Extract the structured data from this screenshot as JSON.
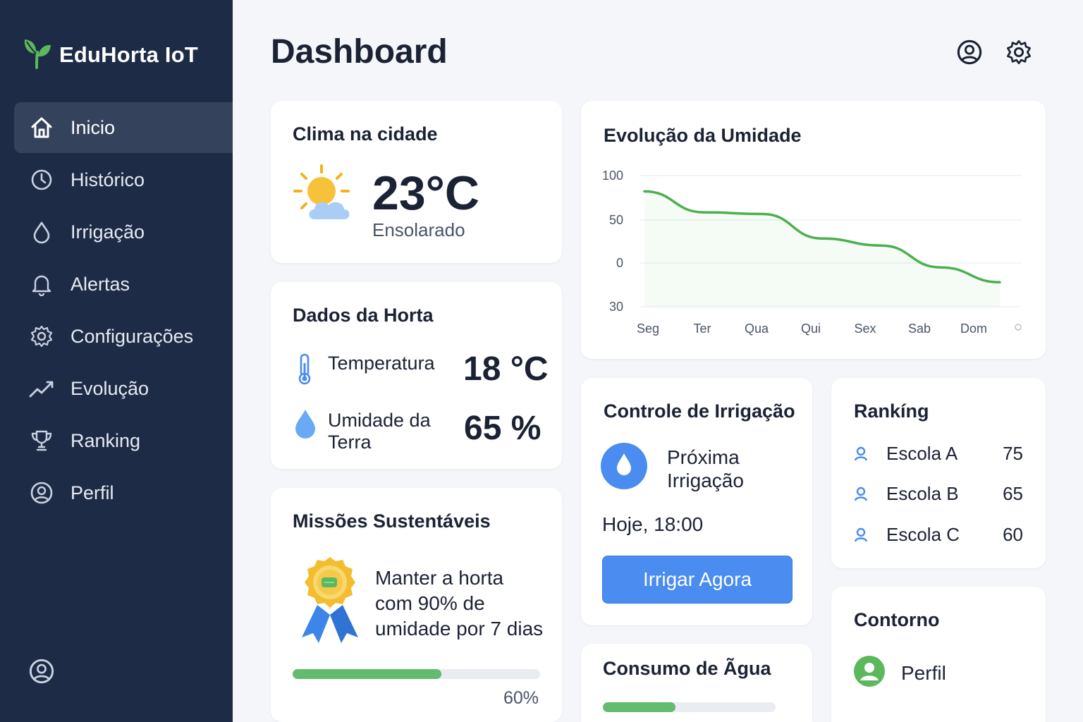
{
  "app": {
    "name": "EduHorta IoT"
  },
  "colors": {
    "sidebar": "#1e2b46",
    "accent_blue": "#4a8cf0",
    "accent_green": "#62bb6e",
    "background": "#f4f6f9"
  },
  "sidebar": {
    "items": [
      {
        "label": "Inicio",
        "icon": "home-icon",
        "active": true
      },
      {
        "label": "Histórico",
        "icon": "clock-icon",
        "active": false
      },
      {
        "label": "Irrigação",
        "icon": "droplet-icon",
        "active": false
      },
      {
        "label": "Alertas",
        "icon": "bell-icon",
        "active": false
      },
      {
        "label": "Configurações",
        "icon": "gear-icon",
        "active": false
      },
      {
        "label": "Evolução",
        "icon": "trend-icon",
        "active": false
      },
      {
        "label": "Ranking",
        "icon": "trophy-icon",
        "active": false
      },
      {
        "label": "Perfil",
        "icon": "user-circle-icon",
        "active": false
      }
    ]
  },
  "header": {
    "title": "Dashboard"
  },
  "weather": {
    "title": "Clima na cidade",
    "temperature": "23°C",
    "condition": "Ensolarado",
    "icon": "sun-cloud-icon"
  },
  "garden": {
    "title": "Dados da Horta",
    "temperature_label": "Temperatura",
    "temperature_value": "18 °C",
    "moisture_label_line1": "Umidade da",
    "moisture_label_line2": "Terra",
    "moisture_value": "65 %"
  },
  "missions": {
    "title": "Missões Sustentáveis",
    "line1": "Manter a horta",
    "line2": "com 90% de",
    "line3": "umidade por 7 dias",
    "progress_percent": 60,
    "progress_label": "60%"
  },
  "irrigation": {
    "title": "Controle de Irrigação",
    "next_line1": "Próxima",
    "next_line2": "Irrigação",
    "time": "Hoje, 18:00",
    "button": "Irrigar Agora"
  },
  "water": {
    "title": "Consumo de Ãgua",
    "progress_percent": 42
  },
  "ranking": {
    "title": "Rankíng",
    "rows": [
      {
        "name": "Escola A",
        "score": "75"
      },
      {
        "name": "Escola B",
        "score": "65"
      },
      {
        "name": "Escola C",
        "score": "60"
      }
    ]
  },
  "contour": {
    "title": "Contorno",
    "profile_label": "Perfil"
  },
  "chart": {
    "title": "Evolução da Umidade"
  },
  "chart_data": {
    "type": "line",
    "title": "Evolução da Umidade",
    "categories": [
      "Seg",
      "Ter",
      "Qua",
      "Qui",
      "Sex",
      "Sab",
      "Dom"
    ],
    "y_tick_labels": [
      "100",
      "50",
      "0",
      "30"
    ],
    "series": [
      {
        "values": [
          82,
          58,
          56,
          28,
          20,
          -5,
          -22
        ]
      }
    ],
    "ylim": [
      -50,
      100
    ],
    "grid": true,
    "xlabel": "",
    "ylabel": ""
  }
}
